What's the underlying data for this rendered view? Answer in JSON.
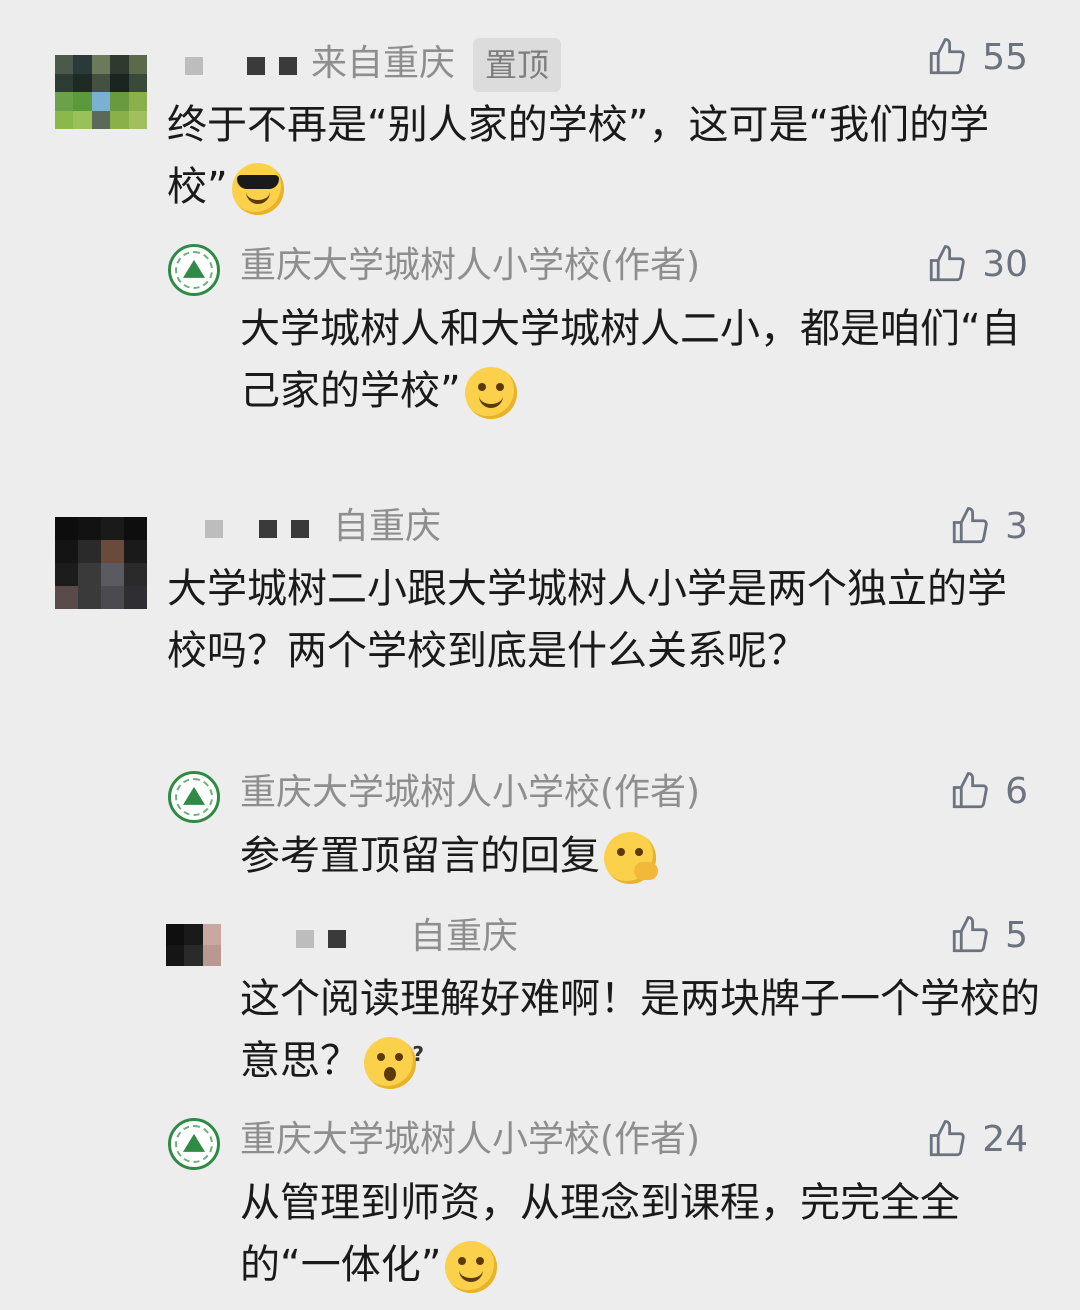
{
  "comments": [
    {
      "location": "来自重庆",
      "badge": "置顶",
      "likes": "55",
      "text": "终于不再是“别人家的学校”，这可是“我们的学校”",
      "emoji": "sunglasses-emoji"
    },
    {
      "author": "重庆大学城树人小学校(作者)",
      "likes": "30",
      "text": "大学城树人和大学城树人二小，都是咱们“自己家的学校”",
      "emoji": "smile-emoji"
    },
    {
      "location": "自重庆",
      "likes": "3",
      "text": "大学城树二小跟大学城树人小学是两个独立的学校吗？两个学校到底是什么关系呢？"
    },
    {
      "author": "重庆大学城树人小学校(作者)",
      "likes": "6",
      "text": "参考置顶留言的回复",
      "emoji": "thinking-emoji"
    },
    {
      "location": "自重庆",
      "likes": "5",
      "text": "这个阅读理解好难啊！是两块牌子一个学校的意思？",
      "emoji": "confused-emoji"
    },
    {
      "author": "重庆大学城树人小学校(作者)",
      "likes": "24",
      "text": "从管理到师资，从理念到课程，完完全全的“一体化”",
      "emoji": "smile-emoji"
    }
  ],
  "colors": {
    "background": "#ededed",
    "meta": "#8e8e8e",
    "text": "#1a1a1a",
    "like_icon": "#6b7280"
  }
}
